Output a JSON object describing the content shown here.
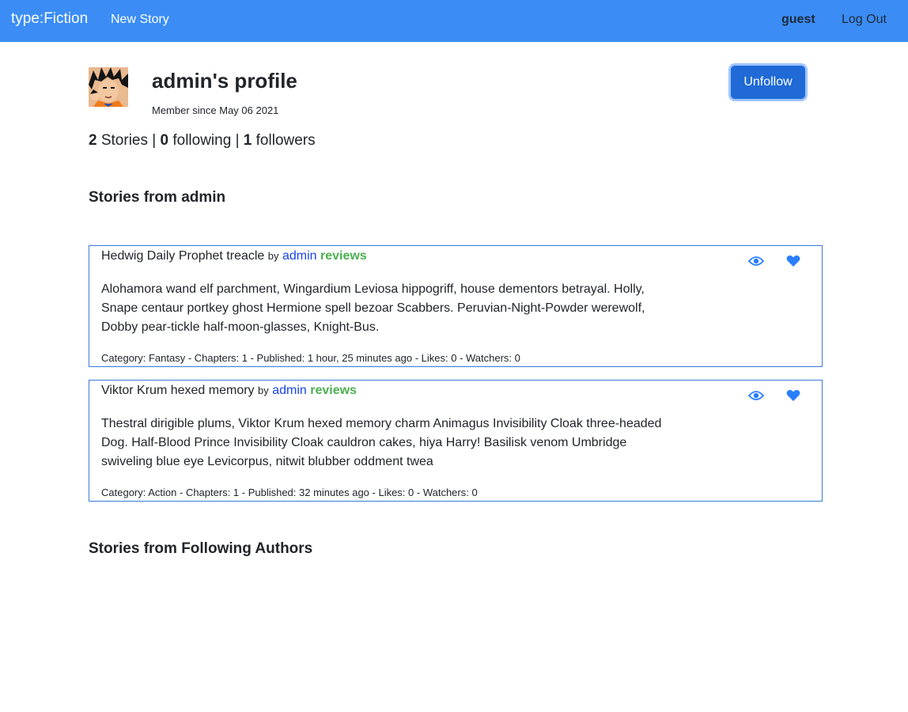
{
  "nav": {
    "brand": "type:Fiction",
    "new_story": "New Story",
    "username": "guest",
    "logout": "Log Out"
  },
  "profile": {
    "title": "admin's profile",
    "member_since": "Member since May 06 2021",
    "follow_button": "Unfollow",
    "stats": {
      "stories_count": "2",
      "stories_label": "Stories",
      "sep": "|",
      "following_count": "0",
      "following_label": "following",
      "followers_count": "1",
      "followers_label": "followers"
    }
  },
  "sections": {
    "own_stories": "Stories from admin",
    "following_stories": "Stories from Following Authors"
  },
  "stories": [
    {
      "title": "Hedwig Daily Prophet treacle",
      "by": "by",
      "author": "admin",
      "reviews": "reviews",
      "text": "Alohamora wand elf parchment, Wingardium Leviosa hippogriff, house dementors betrayal. Holly, Snape centaur portkey ghost Hermione spell bezoar Scabbers. Peruvian-Night-Powder werewolf, Dobby pear-tickle half-moon-glasses, Knight-Bus.",
      "meta": "Category: Fantasy - Chapters: 1 - Published: 1 hour, 25 minutes ago - Likes: 0 - Watchers: 0"
    },
    {
      "title": "Viktor Krum hexed memory",
      "by": "by",
      "author": "admin",
      "reviews": "reviews",
      "text": "Thestral dirigible plums, Viktor Krum hexed memory charm Animagus Invisibility Cloak three-headed Dog. Half-Blood Prince Invisibility Cloak cauldron cakes, hiya Harry! Basilisk venom Umbridge swiveling blue eye Levicorpus, nitwit blubber oddment twea",
      "meta": "Category: Action - Chapters: 1 - Published: 32 minutes ago - Likes: 0 - Watchers: 0"
    }
  ],
  "icons": {
    "watch": "eye-icon",
    "like": "heart-icon",
    "avatar": "avatar-image"
  },
  "colors": {
    "navbar": "#3b8df5",
    "button": "#1f6ad6",
    "icon": "#2a7fff",
    "author_link": "#1a44e8",
    "reviews_link": "#4caf50",
    "card_border": "#3a7bd5"
  }
}
